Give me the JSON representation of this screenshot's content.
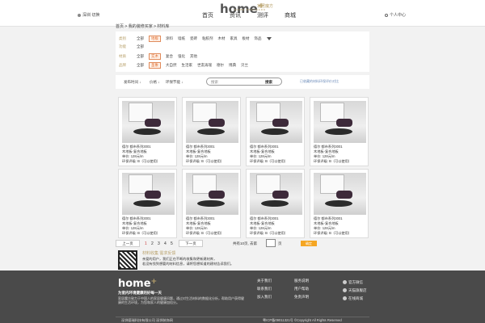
{
  "header": {
    "logo": "home",
    "logo_cn": "家居魔方",
    "logo_sub": "HOME STANDARD",
    "city": "深圳 切换",
    "nav": [
      "首页",
      "资讯",
      "测评",
      "商城"
    ],
    "user": "个人中心"
  },
  "breadcrumb": "首页 > 我的装修买家 > 材料库",
  "filters": {
    "row1": {
      "label": "类别",
      "options": [
        "全部",
        "地板",
        "涂料",
        "墙纸",
        "瓷砖",
        "粘胶剂",
        "木材",
        "家具",
        "板材",
        "饰品"
      ],
      "selected": "地板"
    },
    "row2": {
      "label": "功能",
      "options": [
        "全部"
      ],
      "selected": ""
    },
    "row3": {
      "label": "材质",
      "options": [
        "全部",
        "实木",
        "复合",
        "强化",
        "其他"
      ],
      "selected": "实木"
    },
    "row4": {
      "label": "品牌",
      "options": [
        "全部",
        "圣象",
        "大自然",
        "生活家",
        "世友再瑞",
        "德尔",
        "博典",
        "贝兰"
      ],
      "selected": "圣象"
    }
  },
  "toolbar": {
    "sort_time": "发布时间 ↓",
    "sort_price": "价格 ↓",
    "sort_env": "环保节能 ↓",
    "search_placeholder": "搜索",
    "search_button": "搜索",
    "compare_link": "已收藏的材料环保评价对比"
  },
  "products": [
    {
      "name": "德尔 都市系列3001",
      "type": "木地板-复合地板",
      "price": "单价: 128元/m",
      "eco": "环保评级: B（可以使用）"
    },
    {
      "name": "德尔 都市系列3001",
      "type": "木地板-复合地板",
      "price": "单价: 128元/m",
      "eco": "环保评级: B（可以使用）"
    },
    {
      "name": "德尔 都市系列3001",
      "type": "木地板-复合地板",
      "price": "单价: 128元/m",
      "eco": "环保评级: B（可以使用）"
    },
    {
      "name": "德尔 都市系列3001",
      "type": "木地板-复合地板",
      "price": "单价: 128元/m",
      "eco": "环保评级: B（可以使用）"
    },
    {
      "name": "德尔 都市系列3001",
      "type": "木地板-复合地板",
      "price": "单价: 128元/m",
      "eco": "环保评级: B（可以使用）"
    },
    {
      "name": "德尔 都市系列3001",
      "type": "木地板-复合地板",
      "price": "单价: 128元/m",
      "eco": "环保评级: B（可以使用）"
    },
    {
      "name": "德尔 都市系列3001",
      "type": "木地板-复合地板",
      "price": "单价: 128元/m",
      "eco": "环保评级: B（可以使用）"
    },
    {
      "name": "德尔 都市系列3001",
      "type": "木地板-复合地板",
      "price": "单价: 128元/m",
      "eco": "环保评级: B（可以使用）"
    }
  ],
  "pager": {
    "prev": "上一页",
    "pages": [
      "1",
      "2",
      "3",
      "4",
      "5"
    ],
    "current": "1",
    "next": "下一页",
    "total": "共有10页, 去第",
    "unit": "页",
    "go": "确定"
  },
  "feedback": {
    "title": "材料收集 需求反馈",
    "line1": "亲爱的用户，我们正在不断的收集和更新建材库，",
    "line2": "若没有找到想要的材料信息，请将您想知道的建材告诉我们。"
  },
  "footer": {
    "logo": "home",
    "slogan": "为室内环境健康的好每一天",
    "desc": "家居魔方致力于中国人的家居健康问题，通过对生活材料的数据化分析，帮助用户获得健康的生活环境，为您和家人的健康加倍分。",
    "links": [
      "关于我们",
      "联系我们",
      "加入我们",
      "服务说明",
      "用户帮助",
      "免责声明"
    ],
    "social": [
      "官方微信",
      "天猫旗舰店",
      "在线商城"
    ],
    "company": "深圳德瑞科技有限公司 深圳装饰网",
    "copyright": "粤ICP备09011321号 ©Copyright All Rights Reserved"
  },
  "colors": {
    "accent": "#b8a06a",
    "selected": "#e06a2a",
    "go_button": "#f5a623",
    "footer_bg": "#4a4a4a"
  }
}
